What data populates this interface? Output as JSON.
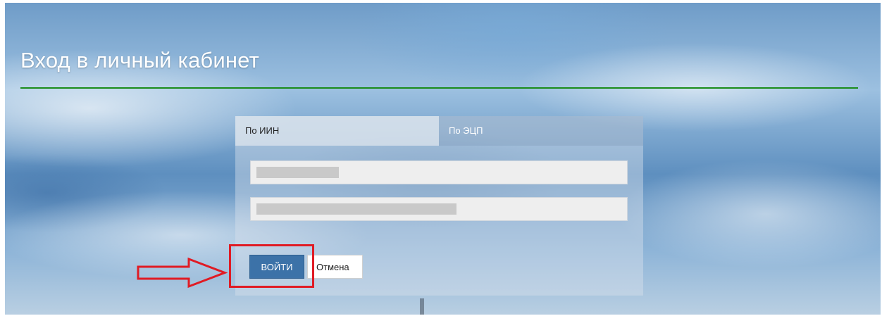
{
  "page": {
    "title": "Вход в личный кабинет"
  },
  "colors": {
    "divider": "#1a8c1a",
    "login_button": "#3c72a8",
    "annotation": "#e01b24"
  },
  "login": {
    "tabs": [
      {
        "label": "По ИИН",
        "active": true
      },
      {
        "label": "По ЭЦП",
        "active": false
      }
    ],
    "fields": {
      "iin": {
        "value": "",
        "redacted": true
      },
      "password": {
        "value": "",
        "redacted": true
      }
    },
    "submit_label": "ВОЙТИ",
    "cancel_label": "Отмена"
  },
  "annotations": {
    "arrow_icon": "right-arrow-outline",
    "highlight": "submit-button-highlight"
  }
}
